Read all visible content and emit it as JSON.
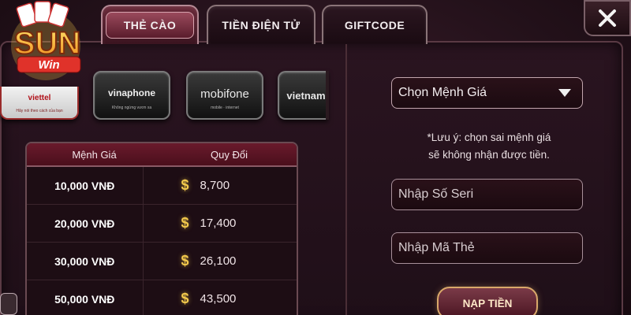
{
  "tabs": [
    {
      "label": "THẺ CÀO",
      "active": true
    },
    {
      "label": "TIỀN ĐIỆN TỬ",
      "active": false
    },
    {
      "label": "GIFTCODE",
      "active": false
    }
  ],
  "logo": {
    "text": "SUN",
    "sub": "Win"
  },
  "carriers": [
    {
      "name": "viettel",
      "label": "viettel",
      "tagline": "Hãy nói theo cách của bạn"
    },
    {
      "name": "vinaphone",
      "label": "vinaphone",
      "tagline": "Không ngừng vươn xa"
    },
    {
      "name": "mobifone",
      "label": "mobifone",
      "tagline": "mobile · internet"
    },
    {
      "name": "vietnamobile",
      "label": "vietnam",
      "tagline": ""
    }
  ],
  "rate_table": {
    "headers": [
      "Mệnh Giá",
      "Quy Đổi"
    ],
    "rows": [
      {
        "denomination": "10,000 VNĐ",
        "value": "8,700"
      },
      {
        "denomination": "20,000 VNĐ",
        "value": "17,400"
      },
      {
        "denomination": "30,000 VNĐ",
        "value": "26,100"
      },
      {
        "denomination": "50,000 VNĐ",
        "value": "43,500"
      }
    ],
    "currency_symbol": "$"
  },
  "form": {
    "select_label": "Chọn Mệnh Giá",
    "note_line1": "*Lưu ý: chọn sai mệnh giá",
    "note_line2": "sẽ không nhận được tiền.",
    "serial_placeholder": "Nhập Số Seri",
    "pin_placeholder": "Nhập Mã Thẻ",
    "submit_label": "NẠP TIỀN"
  },
  "colors": {
    "accent_gold": "#f2c94c",
    "active_tab": "#6a2a3a",
    "header_row": "#6a1a2c"
  }
}
